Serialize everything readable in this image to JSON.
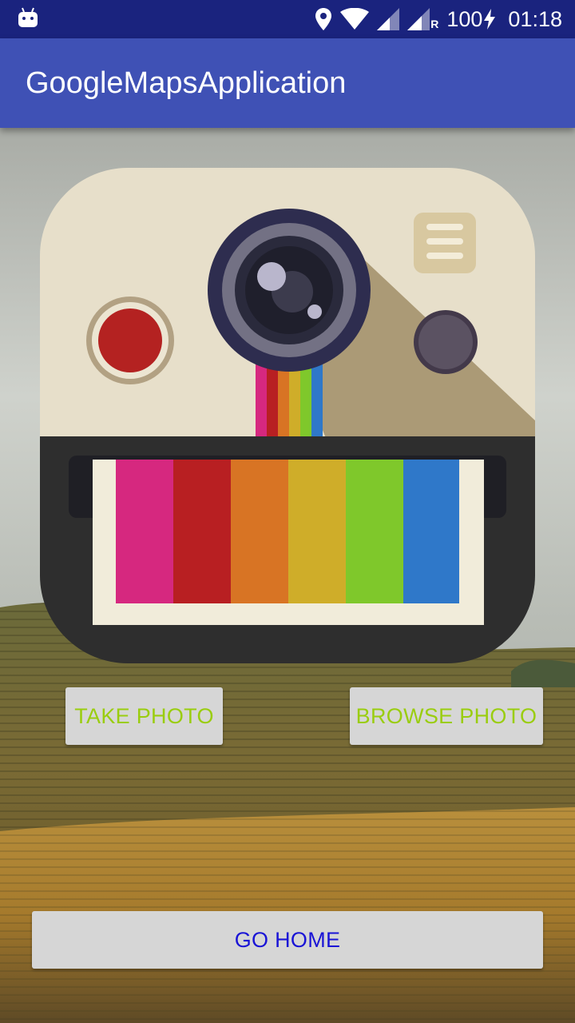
{
  "status_bar": {
    "battery": "100",
    "time": "01:18",
    "network_roaming": "R",
    "icons": [
      "android-debug-icon",
      "location-icon",
      "wifi-icon",
      "signal-icon",
      "signal-roaming-icon",
      "battery-charging-icon"
    ]
  },
  "app_bar": {
    "title": "GoogleMapsApplication"
  },
  "actions": {
    "take_photo": "TAKE PHOTO",
    "browse_photo": "BROWSE PHOTO",
    "go_home": "GO HOME"
  },
  "colors": {
    "status_bar": "#1a237e",
    "app_bar": "#3f51b5",
    "button_bg": "#d6d6d6",
    "photo_button_text": "#9acd0f",
    "home_button_text": "#1a14d6"
  }
}
